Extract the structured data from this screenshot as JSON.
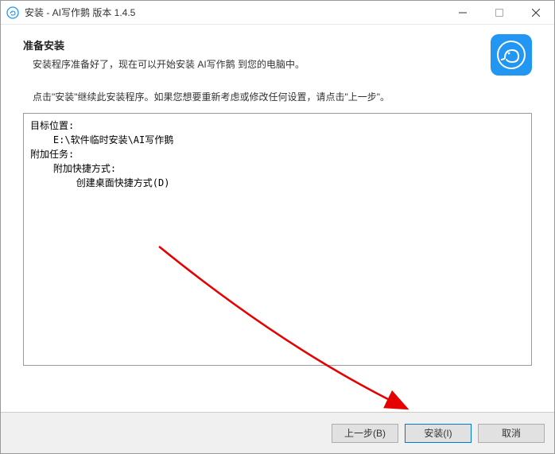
{
  "titlebar": {
    "title": "安装 - AI写作鹅 版本 1.4.5"
  },
  "header": {
    "heading": "准备安装",
    "subheading": "安装程序准备好了，现在可以开始安装 AI写作鹅 到您的电脑中。"
  },
  "instruction": "点击\"安装\"继续此安装程序。如果您想要重新考虑或修改任何设置，请点击\"上一步\"。",
  "summary": {
    "line1": "目标位置:",
    "line2": "    E:\\软件临时安装\\AI写作鹅",
    "line3": "",
    "line4": "附加任务:",
    "line5": "    附加快捷方式:",
    "line6": "        创建桌面快捷方式(D)"
  },
  "buttons": {
    "back": "上一步(B)",
    "install": "安装(I)",
    "cancel": "取消"
  }
}
